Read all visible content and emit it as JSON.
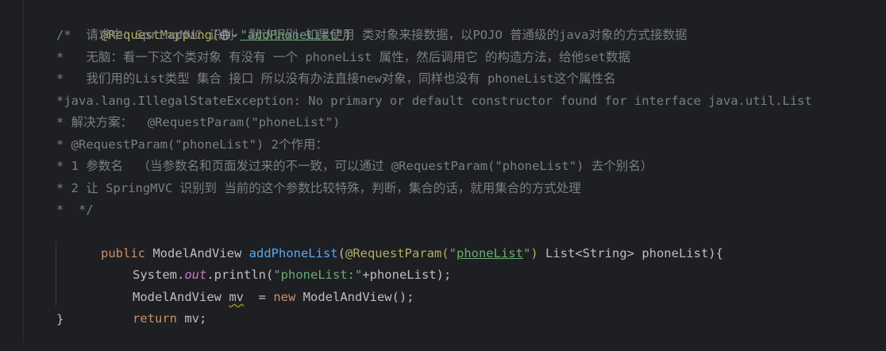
{
  "editor": {
    "line1": {
      "annotation": "@RequestMapping(",
      "string": "\"addPhoneList\"",
      "close": ")"
    },
    "comment_lines": [
      "/*  请求中：SpringMVC 识别  默认识别 如果使用 类对象来接数据，以POJO 普通级的java对象的方式接数据",
      "*   无脑：看一下这个类对象 有没有 一个 phoneList 属性，然后调用它 的构造方法，给他set数据",
      "*   我们用的List类型 集合 接口 所以没有办法直接new对象，同样也没有 phoneList这个属性名",
      "*java.lang.IllegalStateException: No primary or default constructor found for interface java.util.List",
      "* 解决方案：  @RequestParam(\"phoneList\")",
      "* @RequestParam(\"phoneList\") 2个作用：",
      "* 1 参数名  （当参数名和页面发过来的不一致，可以通过 @RequestParam(\"phoneList\") 去个别名）",
      "* 2 让 SpringMVC 识别到 当前的这个参数比较特殊，判断，集合的话，就用集合的方式处理",
      "*  */"
    ],
    "signature": {
      "kw": "public",
      "type": " ModelAndView ",
      "method": "addPhoneList",
      "open": "(",
      "annotation": "@RequestParam(",
      "quote_open": "\"",
      "param_string": "phoneList",
      "quote_close": "\"",
      "annotation_close": ")",
      "rest": " List<String> phoneList){"
    },
    "body1": {
      "obj": "System.",
      "field": "out",
      "call": ".println(",
      "string": "\"phoneList:\"",
      "rest": "+phoneList);"
    },
    "body2": {
      "type": "ModelAndView ",
      "var": "mv",
      "assign": "  = ",
      "kw": "new",
      "rest": " ModelAndView();"
    },
    "body3": {
      "kw": "return",
      "rest": " mv;"
    },
    "closing_brace": "}"
  },
  "icons": [
    "globe-icon",
    "chevron-down-icon"
  ]
}
